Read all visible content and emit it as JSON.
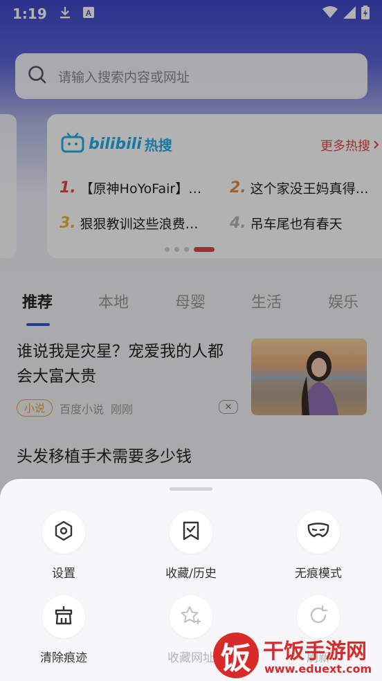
{
  "status_bar": {
    "time": "1:19",
    "download_icon": "download-icon",
    "a_icon": "A"
  },
  "search": {
    "placeholder": "请输入搜索内容或网址"
  },
  "hot_card": {
    "brand": "bilibili",
    "brand_suffix": "热搜",
    "more": "更多热搜",
    "items": [
      {
        "num": "1.",
        "text": "【原神HoYoFair】…",
        "color": "#e0474d"
      },
      {
        "num": "2.",
        "text": "这个家没王妈真得…",
        "color": "#f08a3c"
      },
      {
        "num": "3.",
        "text": "狠狠教训这些浪费…",
        "color": "#f2b53c"
      },
      {
        "num": "4.",
        "text": "吊车尾也有春天",
        "color": "#b5b5b8"
      }
    ]
  },
  "tabs": [
    {
      "label": "推荐"
    },
    {
      "label": "本地"
    },
    {
      "label": "母婴"
    },
    {
      "label": "生活"
    },
    {
      "label": "娱乐"
    }
  ],
  "feed": {
    "article1": {
      "title": "谁说我是灾星？宠爱我的人都会大富大贵",
      "tag": "小说",
      "source": "百度小说",
      "time": "刚刚"
    },
    "article2": {
      "title": "头发移植手术需要多少钱"
    }
  },
  "menu": [
    {
      "label": "设置",
      "icon": "settings-icon",
      "disabled": false
    },
    {
      "label": "收藏/历史",
      "icon": "bookmark-history-icon",
      "disabled": false
    },
    {
      "label": "无痕模式",
      "icon": "mask-icon",
      "disabled": false
    },
    {
      "label": "清除痕迹",
      "icon": "clear-trace-icon",
      "disabled": false
    },
    {
      "label": "收藏网址",
      "icon": "star-add-icon",
      "disabled": true
    },
    {
      "label": "刷新",
      "icon": "refresh-icon",
      "disabled": true
    }
  ],
  "watermark": {
    "char": "饭",
    "title": "干饭手游网",
    "url": "www.eduext.com"
  }
}
